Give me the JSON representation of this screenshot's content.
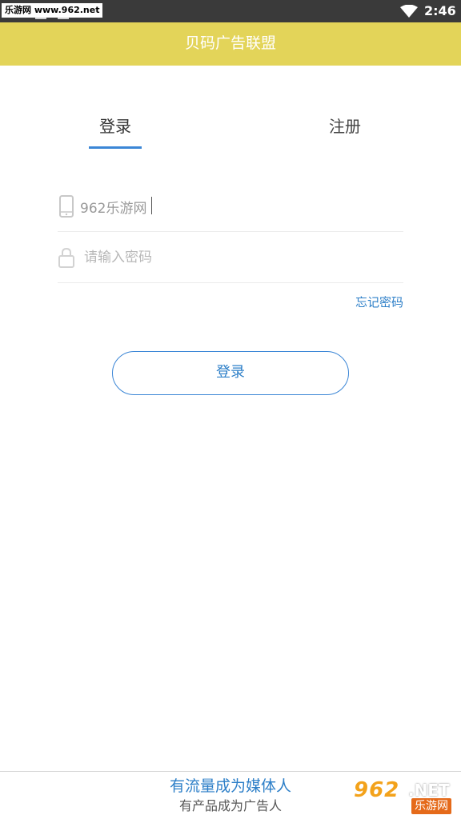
{
  "status_bar": {
    "watermark_tag": "乐游网 www.962.net",
    "time": "2:46",
    "icons": [
      "wifi-icon"
    ]
  },
  "app_bar": {
    "title": "贝码广告联盟",
    "background": "#e3d459"
  },
  "tabs": [
    {
      "label": "登录",
      "active": true
    },
    {
      "label": "注册",
      "active": false
    }
  ],
  "form": {
    "phone": {
      "value": "962乐游网",
      "icon": "phone-icon"
    },
    "password": {
      "value": "",
      "placeholder": "请输入密码",
      "icon": "lock-icon"
    },
    "forgot_label": "忘记密码",
    "submit_label": "登录"
  },
  "footer": {
    "primary_link": "有流量成为媒体人",
    "secondary_link": "有产品成为广告人"
  },
  "watermark": {
    "number": "962",
    "suffix": ".NET",
    "cn": "乐游网"
  },
  "colors": {
    "accent": "#3b86d6",
    "link": "#2d7fc8"
  }
}
